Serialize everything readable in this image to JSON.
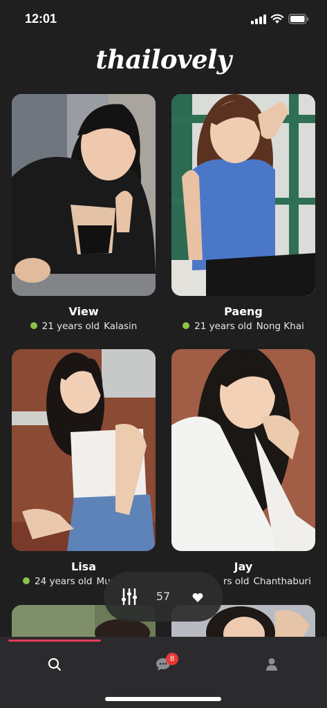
{
  "status": {
    "time": "12:01"
  },
  "app": {
    "logo": "thailovely"
  },
  "profiles": [
    {
      "name": "View",
      "age_text": "21 years old",
      "city": "Kalasin",
      "online": true,
      "photo": "photo-woman-black-cardigan"
    },
    {
      "name": "Paeng",
      "age_text": "21 years old",
      "city": "Nong Khai",
      "online": true,
      "photo": "photo-woman-blue-top"
    },
    {
      "name": "Lisa",
      "age_text": "24 years old",
      "city": "Mu",
      "online": true,
      "photo": "photo-woman-white-camisole"
    },
    {
      "name": "Jay",
      "age_text": "rs old",
      "city": "Chanthaburi",
      "online": true,
      "photo": "photo-woman-white-shirt"
    }
  ],
  "filter": {
    "count": "57",
    "left_icon": "sliders-icon",
    "right_icon": "heart-icon"
  },
  "tabs": [
    {
      "id": "search",
      "icon": "search-icon"
    },
    {
      "id": "messages",
      "icon": "chat-bubble-icon",
      "badge": "8"
    },
    {
      "id": "profile",
      "icon": "person-icon"
    }
  ],
  "colors": {
    "accent": "#e63b5c",
    "online": "#8bc34a",
    "badge": "#e53935",
    "background": "#1f1f1f"
  }
}
